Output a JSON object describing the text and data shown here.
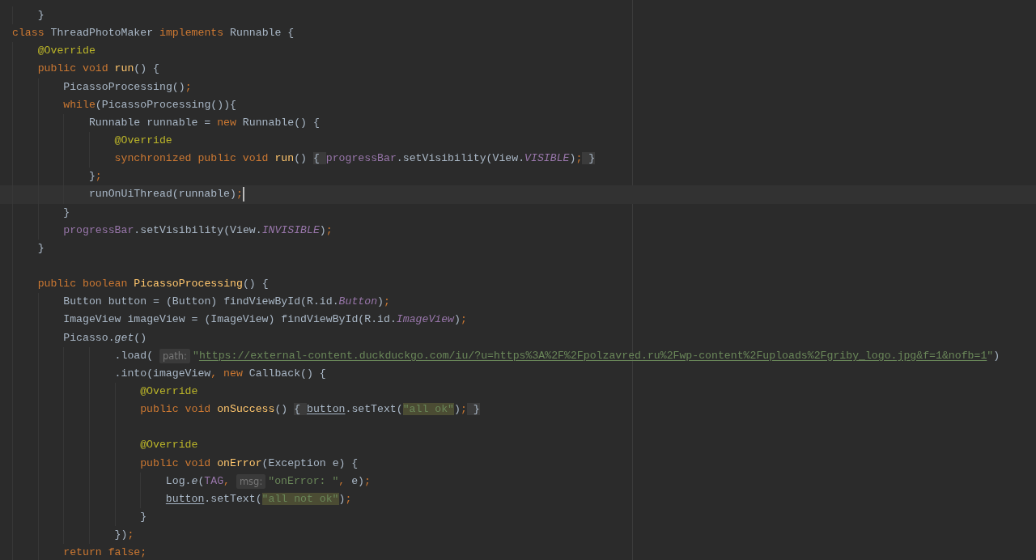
{
  "editor": {
    "lines": [
      {
        "children": [
          {
            "current": false,
            "tokens": [
              {
                "kind": "plain",
                "text": "}"
              }
            ]
          }
        ]
      },
      {
        "current": false,
        "tokens": [
          {
            "kind": "keyword",
            "text": "class "
          },
          {
            "kind": "plain",
            "text": "ThreadPhotoMaker "
          },
          {
            "kind": "keyword",
            "text": "implements "
          },
          {
            "kind": "plain",
            "text": "Runnable {"
          }
        ],
        "children": [
          {
            "current": false,
            "tokens": [
              {
                "kind": "annotation",
                "text": "@Override"
              }
            ]
          },
          {
            "current": false,
            "tokens": [
              {
                "kind": "keyword",
                "text": "public void "
              },
              {
                "kind": "decl",
                "text": "run"
              },
              {
                "kind": "plain",
                "text": "() {"
              }
            ],
            "children": [
              {
                "current": false,
                "tokens": [
                  {
                    "kind": "plain",
                    "text": "PicassoProcessing()"
                  },
                  {
                    "kind": "keyword",
                    "text": ";"
                  }
                ]
              },
              {
                "current": false,
                "tokens": [
                  {
                    "kind": "keyword",
                    "text": "while"
                  },
                  {
                    "kind": "plain",
                    "text": "(PicassoProcessing()){"
                  }
                ],
                "children": [
                  {
                    "current": false,
                    "tokens": [
                      {
                        "kind": "plain",
                        "text": "Runnable runnable = "
                      },
                      {
                        "kind": "keyword",
                        "text": "new "
                      },
                      {
                        "kind": "plain",
                        "text": "Runnable() {"
                      }
                    ],
                    "children": [
                      {
                        "current": false,
                        "tokens": [
                          {
                            "kind": "annotation",
                            "text": "@Override"
                          }
                        ]
                      },
                      {
                        "current": false,
                        "tokens": [
                          {
                            "kind": "keyword",
                            "text": "synchronized public void "
                          },
                          {
                            "kind": "decl",
                            "text": "run"
                          },
                          {
                            "kind": "plain",
                            "text": "() "
                          },
                          {
                            "kind": "fold",
                            "text": "{ "
                          },
                          {
                            "kind": "field",
                            "text": "progressBar"
                          },
                          {
                            "kind": "plain",
                            "text": ".setVisibility(View."
                          },
                          {
                            "kind": "constant",
                            "text": "VISIBLE"
                          },
                          {
                            "kind": "plain",
                            "text": ")"
                          },
                          {
                            "kind": "keyword",
                            "text": ";"
                          },
                          {
                            "kind": "fold",
                            "text": " }"
                          }
                        ]
                      }
                    ]
                  },
                  {
                    "current": false,
                    "tokens": [
                      {
                        "kind": "plain",
                        "text": "}"
                      },
                      {
                        "kind": "keyword",
                        "text": ";"
                      }
                    ]
                  },
                  {
                    "current": true,
                    "tokens": [
                      {
                        "kind": "plain",
                        "text": "runOnUiThread(runnable)"
                      },
                      {
                        "kind": "keyword",
                        "text": ";"
                      }
                    ]
                  }
                ]
              },
              {
                "current": false,
                "tokens": [
                  {
                    "kind": "plain",
                    "text": "}"
                  }
                ]
              },
              {
                "current": false,
                "tokens": [
                  {
                    "kind": "field",
                    "text": "progressBar"
                  },
                  {
                    "kind": "plain",
                    "text": ".setVisibility(View."
                  },
                  {
                    "kind": "constant",
                    "text": "INVISIBLE"
                  },
                  {
                    "kind": "plain",
                    "text": ")"
                  },
                  {
                    "kind": "keyword",
                    "text": ";"
                  }
                ]
              }
            ]
          },
          {
            "current": false,
            "tokens": [
              {
                "kind": "plain",
                "text": "}"
              }
            ]
          },
          {
            "current": false
          },
          {
            "current": false,
            "tokens": [
              {
                "kind": "keyword",
                "text": "public boolean "
              },
              {
                "kind": "decl",
                "text": "PicassoProcessing"
              },
              {
                "kind": "plain",
                "text": "() {"
              }
            ],
            "children": [
              {
                "current": false,
                "tokens": [
                  {
                    "kind": "plain",
                    "text": "Button button = (Button) findViewById(R.id."
                  },
                  {
                    "kind": "constant",
                    "text": "Button"
                  },
                  {
                    "kind": "plain",
                    "text": ")"
                  },
                  {
                    "kind": "keyword",
                    "text": ";"
                  }
                ]
              },
              {
                "current": false,
                "tokens": [
                  {
                    "kind": "plain",
                    "text": "ImageView imageView = (ImageView) findViewById(R.id."
                  },
                  {
                    "kind": "constant",
                    "text": "ImageView"
                  },
                  {
                    "kind": "plain",
                    "text": ")"
                  },
                  {
                    "kind": "keyword",
                    "text": ";"
                  }
                ]
              },
              {
                "current": false,
                "continuation": true,
                "tokens": [
                  {
                    "kind": "plain",
                    "text": "Picasso."
                  },
                  {
                    "kind": "static",
                    "text": "get"
                  },
                  {
                    "kind": "plain",
                    "text": "()"
                  }
                ],
                "children": [
                  {
                    "current": false,
                    "tokens": [
                      {
                        "kind": "plain",
                        "text": ".load( "
                      },
                      {
                        "kind": "hint",
                        "text": "path:"
                      },
                      {
                        "kind": "string",
                        "text": "\""
                      },
                      {
                        "kind": "link",
                        "text": "https://external-content.duckduckgo.com/iu/?u=https%3A%2F%2Fpolzavred.ru%2Fwp-content%2Fuploads%2Fgriby_logo.jpg&f=1&nofb=1"
                      },
                      {
                        "kind": "string",
                        "text": "\""
                      },
                      {
                        "kind": "plain",
                        "text": ")"
                      }
                    ]
                  },
                  {
                    "current": false,
                    "tokens": [
                      {
                        "kind": "plain",
                        "text": ".into(imageView"
                      },
                      {
                        "kind": "keyword",
                        "text": ", new "
                      },
                      {
                        "kind": "plain",
                        "text": "Callback() {"
                      }
                    ],
                    "children": [
                      {
                        "current": false,
                        "tokens": [
                          {
                            "kind": "annotation",
                            "text": "@Override"
                          }
                        ]
                      },
                      {
                        "current": false,
                        "tokens": [
                          {
                            "kind": "keyword",
                            "text": "public void "
                          },
                          {
                            "kind": "decl",
                            "text": "onSuccess"
                          },
                          {
                            "kind": "plain",
                            "text": "() "
                          },
                          {
                            "kind": "fold",
                            "text": "{ "
                          },
                          {
                            "kind": "captured",
                            "text": "button"
                          },
                          {
                            "kind": "plain",
                            "text": ".setText("
                          },
                          {
                            "kind": "match",
                            "text": "\"all ok\""
                          },
                          {
                            "kind": "plain",
                            "text": ")"
                          },
                          {
                            "kind": "keyword",
                            "text": ";"
                          },
                          {
                            "kind": "fold",
                            "text": " }"
                          }
                        ]
                      },
                      {
                        "current": false
                      },
                      {
                        "current": false,
                        "tokens": [
                          {
                            "kind": "annotation",
                            "text": "@Override"
                          }
                        ]
                      },
                      {
                        "current": false,
                        "tokens": [
                          {
                            "kind": "keyword",
                            "text": "public void "
                          },
                          {
                            "kind": "decl",
                            "text": "onError"
                          },
                          {
                            "kind": "plain",
                            "text": "(Exception e) {"
                          }
                        ],
                        "children": [
                          {
                            "current": false,
                            "tokens": [
                              {
                                "kind": "plain",
                                "text": "Log."
                              },
                              {
                                "kind": "static",
                                "text": "e"
                              },
                              {
                                "kind": "plain",
                                "text": "("
                              },
                              {
                                "kind": "field",
                                "text": "TAG"
                              },
                              {
                                "kind": "keyword",
                                "text": ", "
                              },
                              {
                                "kind": "hint",
                                "text": "msg:"
                              },
                              {
                                "kind": "string",
                                "text": "\"onError: \""
                              },
                              {
                                "kind": "keyword",
                                "text": ", "
                              },
                              {
                                "kind": "plain",
                                "text": "e)"
                              },
                              {
                                "kind": "keyword",
                                "text": ";"
                              }
                            ]
                          },
                          {
                            "current": false,
                            "tokens": [
                              {
                                "kind": "captured",
                                "text": "button"
                              },
                              {
                                "kind": "plain",
                                "text": ".setText("
                              },
                              {
                                "kind": "match",
                                "text": "\"all not ok\""
                              },
                              {
                                "kind": "plain",
                                "text": ")"
                              },
                              {
                                "kind": "keyword",
                                "text": ";"
                              }
                            ]
                          }
                        ]
                      },
                      {
                        "current": false,
                        "tokens": [
                          {
                            "kind": "plain",
                            "text": "}"
                          }
                        ]
                      }
                    ]
                  },
                  {
                    "current": false,
                    "tokens": [
                      {
                        "kind": "plain",
                        "text": "})"
                      },
                      {
                        "kind": "keyword",
                        "text": ";"
                      }
                    ]
                  }
                ]
              },
              {
                "current": false,
                "tokens": [
                  {
                    "kind": "keyword",
                    "text": "return false;"
                  }
                ]
              }
            ]
          }
        ]
      }
    ]
  }
}
